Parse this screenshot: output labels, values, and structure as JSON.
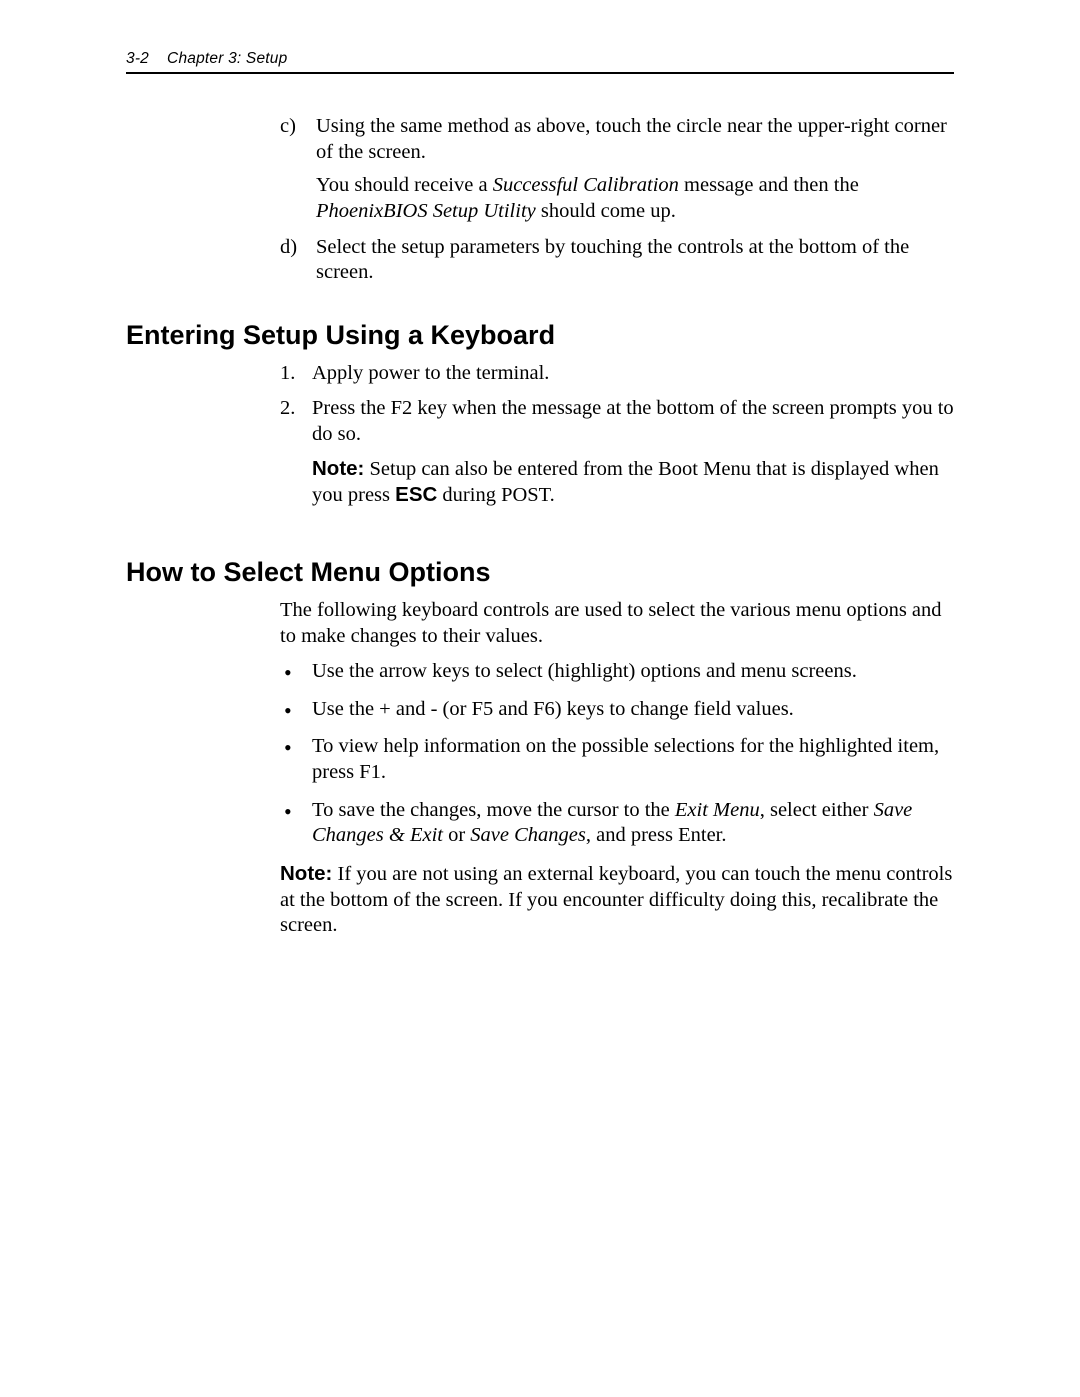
{
  "header": {
    "page_num": "3-2",
    "chapter": "Chapter 3: Setup"
  },
  "lettered": {
    "c": {
      "marker": "c)",
      "text": "Using the same method as above, touch the circle near the upper-right corner of the screen.",
      "sub_prefix": "You should receive a ",
      "sub_em1": "Successful Calibration",
      "sub_mid": " message and then the ",
      "sub_em2": "PhoenixBIOS Setup Utility",
      "sub_suffix": " should come up."
    },
    "d": {
      "marker": "d)",
      "text": "Select the setup parameters by touching the controls at the bottom of the screen."
    }
  },
  "section1": {
    "title": "Entering Setup Using a Keyboard",
    "items": {
      "one": {
        "marker": "1.",
        "text": "Apply power to the terminal."
      },
      "two": {
        "marker": "2.",
        "text": "Press the F2 key when the message at the bottom of the screen prompts you to do so.",
        "note_label": "Note:",
        "note_pre": "  Setup can also be entered from the Boot Menu that is displayed when you press ",
        "note_esc": "ESC",
        "note_post": " during POST."
      }
    }
  },
  "section2": {
    "title": "How to Select Menu Options",
    "intro": "The following keyboard controls are used to select the various menu options and to make changes to their values.",
    "bullets": {
      "b1": "Use the arrow keys to select (highlight) options and menu screens.",
      "b2": "Use the + and - (or F5 and F6) keys to change field values.",
      "b3": "To view help information on the possible selections for the highlighted item, press F1.",
      "b4_pre": "To save the changes, move the cursor to the ",
      "b4_em1": "Exit Menu",
      "b4_mid": ", select either ",
      "b4_em2": "Save Changes & Exit",
      "b4_or": " or ",
      "b4_em3": "Save Changes",
      "b4_post": ", and press Enter."
    },
    "note_label": "Note:",
    "note_text": "  If you are not using an external keyboard, you can touch the menu controls at the bottom of the screen. If you encounter difficulty doing this, recalibrate the screen."
  }
}
